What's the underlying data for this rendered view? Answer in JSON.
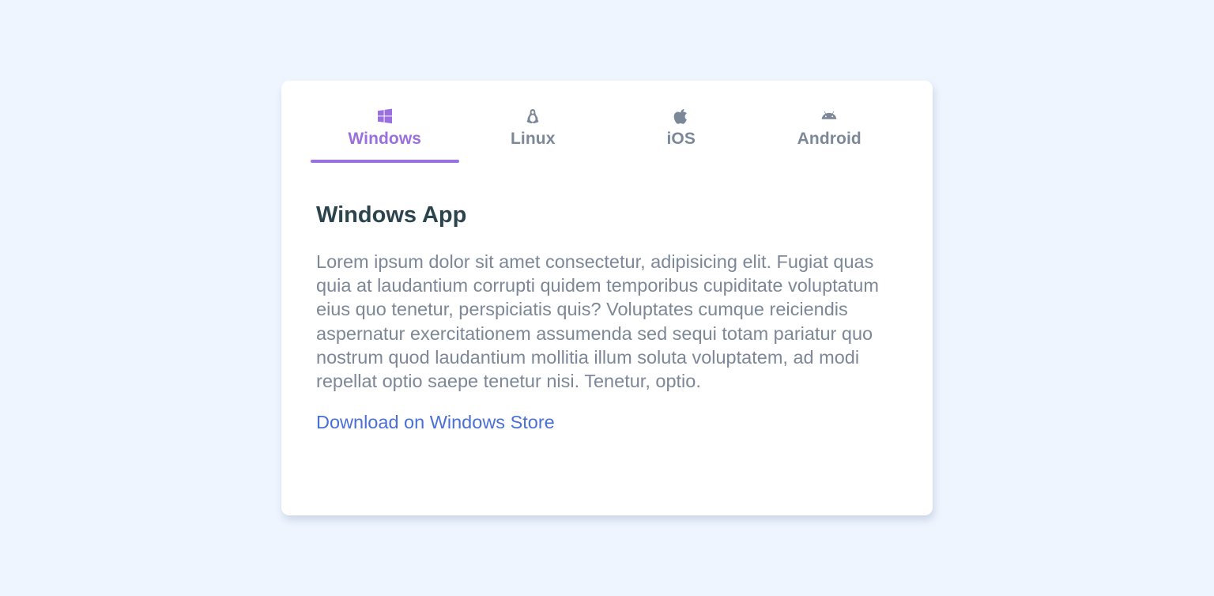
{
  "tabs": [
    {
      "label": "Windows",
      "icon": "windows-icon",
      "active": true
    },
    {
      "label": "Linux",
      "icon": "linux-icon",
      "active": false
    },
    {
      "label": "iOS",
      "icon": "apple-icon",
      "active": false
    },
    {
      "label": "Android",
      "icon": "android-icon",
      "active": false
    }
  ],
  "panel": {
    "title": "Windows App",
    "body": "Lorem ipsum dolor sit amet consectetur, adipisicing elit. Fugiat quas quia at laudantium corrupti quidem temporibus cupiditate voluptatum eius quo tenetur, perspiciatis quis? Voluptates cumque reiciendis aspernatur exercitationem assumenda sed sequi totam pariatur quo nostrum quod laudantium mollitia illum soluta voluptatem, ad modi repellat optio saepe tenetur nisi. Tenetur, optio.",
    "link": "Download on Windows Store"
  },
  "colors": {
    "accent": "#9a6fdf",
    "tab_inactive": "#7c8797",
    "title": "#2c444d",
    "link": "#4a6fd7",
    "background": "#eef5ff"
  }
}
